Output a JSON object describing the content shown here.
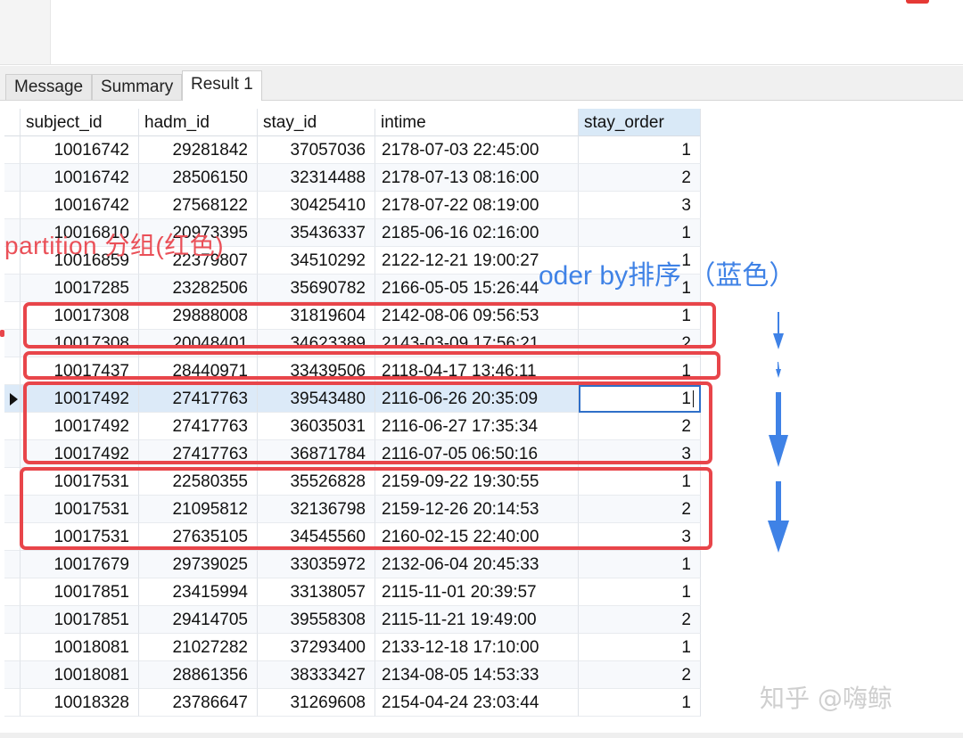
{
  "tabs": [
    {
      "label": "Message"
    },
    {
      "label": "Summary"
    },
    {
      "label": "Result 1",
      "active": true
    }
  ],
  "grid": {
    "columns": [
      "subject_id",
      "hadm_id",
      "stay_id",
      "intime",
      "stay_order"
    ],
    "rows": [
      [
        "10016742",
        "29281842",
        "37057036",
        "2178-07-03 22:45:00",
        "1"
      ],
      [
        "10016742",
        "28506150",
        "32314488",
        "2178-07-13 08:16:00",
        "2"
      ],
      [
        "10016742",
        "27568122",
        "30425410",
        "2178-07-22 08:19:00",
        "3"
      ],
      [
        "10016810",
        "20973395",
        "35436337",
        "2185-06-16 02:16:00",
        "1"
      ],
      [
        "10016859",
        "22379807",
        "34510292",
        "2122-12-21 19:00:27",
        "1"
      ],
      [
        "10017285",
        "23282506",
        "35690782",
        "2166-05-05 15:26:44",
        "1"
      ],
      [
        "10017308",
        "29888008",
        "31819604",
        "2142-08-06 09:56:53",
        "1"
      ],
      [
        "10017308",
        "20048401",
        "34623389",
        "2143-03-09 17:56:21",
        "2"
      ],
      [
        "10017437",
        "28440971",
        "33439506",
        "2118-04-17 13:46:11",
        "1"
      ],
      [
        "10017492",
        "27417763",
        "39543480",
        "2116-06-26 20:35:09",
        "1"
      ],
      [
        "10017492",
        "27417763",
        "36035031",
        "2116-06-27 17:35:34",
        "2"
      ],
      [
        "10017492",
        "27417763",
        "36871784",
        "2116-07-05 06:50:16",
        "3"
      ],
      [
        "10017531",
        "22580355",
        "35526828",
        "2159-09-22 19:30:55",
        "1"
      ],
      [
        "10017531",
        "21095812",
        "32136798",
        "2159-12-26 20:14:53",
        "2"
      ],
      [
        "10017531",
        "27635105",
        "34545560",
        "2160-02-15 22:40:00",
        "3"
      ],
      [
        "10017679",
        "29739025",
        "33035972",
        "2132-06-04 20:45:33",
        "1"
      ],
      [
        "10017851",
        "23415994",
        "33138057",
        "2115-11-01 20:39:57",
        "1"
      ],
      [
        "10017851",
        "29414705",
        "39558308",
        "2115-11-21 19:49:00",
        "2"
      ],
      [
        "10018081",
        "21027282",
        "37293400",
        "2133-12-18 17:10:00",
        "1"
      ],
      [
        "10018081",
        "28861356",
        "38333427",
        "2134-08-05 14:53:33",
        "2"
      ],
      [
        "10018328",
        "23786647",
        "31269608",
        "2154-04-24 23:03:44",
        "1"
      ]
    ],
    "selected_row": 9
  },
  "annotations": {
    "partition_label": "partition 分组(红色)",
    "order_label": "oder by排序 （蓝色）",
    "red_color": "#e8454a",
    "blue_color": "#3f82e6"
  },
  "watermark": "知乎 @嗨鲸"
}
